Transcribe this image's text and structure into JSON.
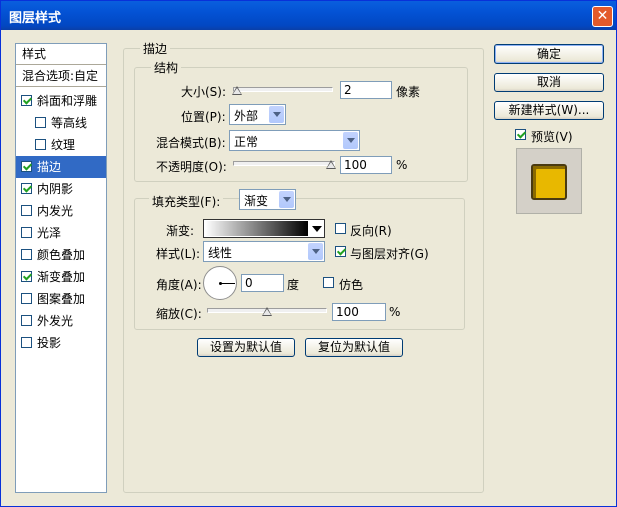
{
  "window": {
    "title": "图层样式",
    "close_label": "✕"
  },
  "left": {
    "header": "样式",
    "blend_options": "混合选项:自定",
    "items": [
      {
        "label": "斜面和浮雕",
        "checked": true,
        "indent": 0
      },
      {
        "label": "等高线",
        "checked": false,
        "indent": 1
      },
      {
        "label": "纹理",
        "checked": false,
        "indent": 1
      },
      {
        "label": "描边",
        "checked": true,
        "indent": 0,
        "selected": true
      },
      {
        "label": "内阴影",
        "checked": true,
        "indent": 0
      },
      {
        "label": "内发光",
        "checked": false,
        "indent": 0
      },
      {
        "label": "光泽",
        "checked": false,
        "indent": 0
      },
      {
        "label": "颜色叠加",
        "checked": false,
        "indent": 0
      },
      {
        "label": "渐变叠加",
        "checked": true,
        "indent": 0
      },
      {
        "label": "图案叠加",
        "checked": false,
        "indent": 0
      },
      {
        "label": "外发光",
        "checked": false,
        "indent": 0
      },
      {
        "label": "投影",
        "checked": false,
        "indent": 0
      }
    ]
  },
  "stroke": {
    "group_title": "描边",
    "structure_title": "结构",
    "size_label": "大小(S):",
    "size_value": "2",
    "size_unit": "像素",
    "size_level": 0.02,
    "position_label": "位置(P):",
    "position_value": "外部",
    "blend_label": "混合模式(B):",
    "blend_value": "正常",
    "opacity_label": "不透明度(O):",
    "opacity_value": "100",
    "opacity_unit": "%",
    "opacity_level": 1.0,
    "fill_type_label": "填充类型(F):",
    "fill_type_value": "渐变",
    "gradient_label": "渐变:",
    "reverse_label": "反向(R)",
    "reverse_checked": false,
    "style_label": "样式(L):",
    "style_value": "线性",
    "align_label": "与图层对齐(G)",
    "align_checked": true,
    "angle_label": "角度(A):",
    "angle_value": "0",
    "angle_unit": "度",
    "dither_label": "仿色",
    "dither_checked": false,
    "scale_label": "缩放(C):",
    "scale_value": "100",
    "scale_unit": "%",
    "scale_level": 0.5,
    "set_default": "设置为默认值",
    "reset_default": "复位为默认值"
  },
  "right": {
    "ok": "确定",
    "cancel": "取消",
    "new_style": "新建样式(W)...",
    "preview_label": "预览(V)",
    "preview_checked": true
  },
  "colors": {
    "accent": "#316ac5",
    "preview_fill": "#e8b800",
    "title_bar": "#0a5fde"
  }
}
